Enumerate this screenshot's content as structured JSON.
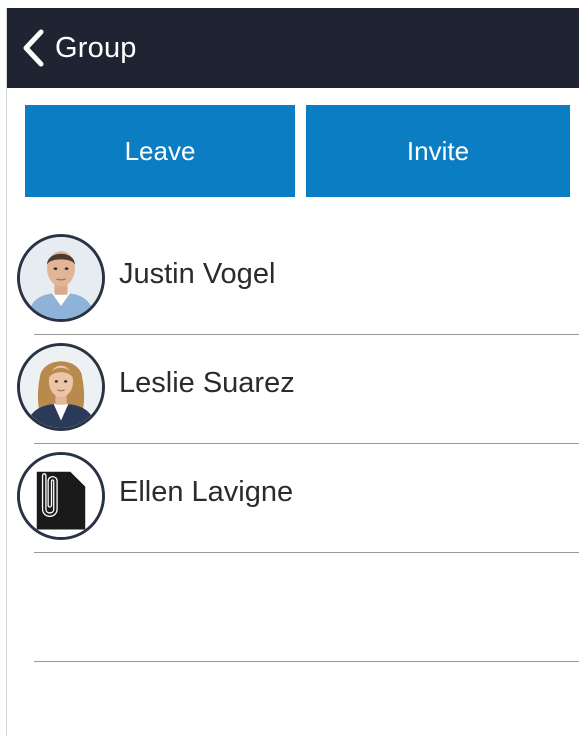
{
  "navbar": {
    "back_icon": "chevron-left-icon",
    "title": "Group",
    "background": "#1f2432"
  },
  "actions": {
    "leave_label": "Leave",
    "invite_label": "Invite",
    "button_color": "#0b7ec3"
  },
  "members": [
    {
      "name": "Justin Vogel",
      "avatar": "photo-man"
    },
    {
      "name": "Leslie Suarez",
      "avatar": "photo-woman"
    },
    {
      "name": "Ellen Lavigne",
      "avatar": "document-clip-icon"
    }
  ]
}
